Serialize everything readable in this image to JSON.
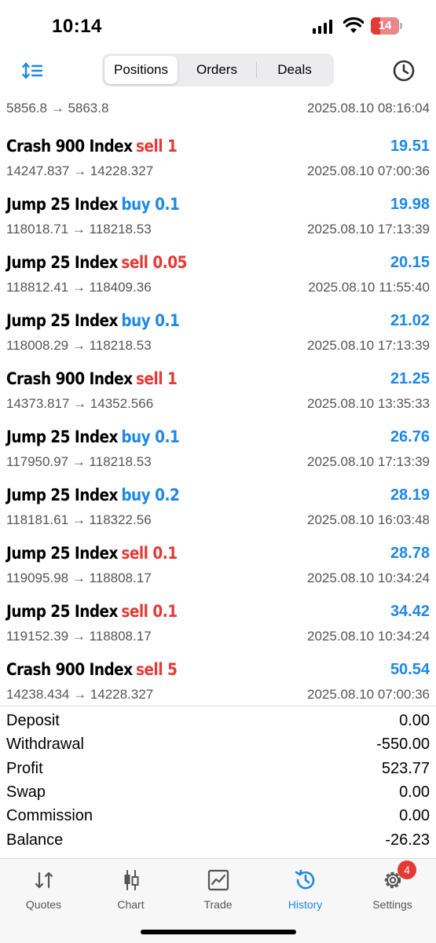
{
  "status_bar": {
    "time": "10:14",
    "battery": "14"
  },
  "header": {
    "segments": [
      "Positions",
      "Orders",
      "Deals"
    ],
    "active_segment": "Positions"
  },
  "partial_row": {
    "prices": "5856.8 → 5863.8",
    "time": "2025.08.10 08:16:04"
  },
  "deals": [
    {
      "symbol": "Crash 900 Index",
      "side": "sell",
      "volume": "1",
      "profit": "19.51",
      "prices": "14247.837 → 14228.327",
      "time": "2025.08.10 07:00:36"
    },
    {
      "symbol": "Jump 25 Index",
      "side": "buy",
      "volume": "0.1",
      "profit": "19.98",
      "prices": "118018.71 → 118218.53",
      "time": "2025.08.10 17:13:39"
    },
    {
      "symbol": "Jump 25 Index",
      "side": "sell",
      "volume": "0.05",
      "profit": "20.15",
      "prices": "118812.41 → 118409.36",
      "time": "2025.08.10 11:55:40"
    },
    {
      "symbol": "Jump 25 Index",
      "side": "buy",
      "volume": "0.1",
      "profit": "21.02",
      "prices": "118008.29 → 118218.53",
      "time": "2025.08.10 17:13:39"
    },
    {
      "symbol": "Crash 900 Index",
      "side": "sell",
      "volume": "1",
      "profit": "21.25",
      "prices": "14373.817 → 14352.566",
      "time": "2025.08.10 13:35:33"
    },
    {
      "symbol": "Jump 25 Index",
      "side": "buy",
      "volume": "0.1",
      "profit": "26.76",
      "prices": "117950.97 → 118218.53",
      "time": "2025.08.10 17:13:39"
    },
    {
      "symbol": "Jump 25 Index",
      "side": "buy",
      "volume": "0.2",
      "profit": "28.19",
      "prices": "118181.61 → 118322.56",
      "time": "2025.08.10 16:03:48"
    },
    {
      "symbol": "Jump 25 Index",
      "side": "sell",
      "volume": "0.1",
      "profit": "28.78",
      "prices": "119095.98 → 118808.17",
      "time": "2025.08.10 10:34:24"
    },
    {
      "symbol": "Jump 25 Index",
      "side": "sell",
      "volume": "0.1",
      "profit": "34.42",
      "prices": "119152.39 → 118808.17",
      "time": "2025.08.10 10:34:24"
    },
    {
      "symbol": "Crash 900 Index",
      "side": "sell",
      "volume": "5",
      "profit": "50.54",
      "prices": "14238.434 → 14228.327",
      "time": "2025.08.10 07:00:36"
    }
  ],
  "summary": [
    {
      "label": "Deposit",
      "value": "0.00"
    },
    {
      "label": "Withdrawal",
      "value": "-550.00"
    },
    {
      "label": "Profit",
      "value": "523.77"
    },
    {
      "label": "Swap",
      "value": "0.00"
    },
    {
      "label": "Commission",
      "value": "0.00"
    },
    {
      "label": "Balance",
      "value": "-26.23"
    }
  ],
  "tabbar": {
    "tabs": [
      {
        "label": "Quotes",
        "icon": "quotes-arrows-icon"
      },
      {
        "label": "Chart",
        "icon": "candlestick-icon"
      },
      {
        "label": "Trade",
        "icon": "trade-chart-icon"
      },
      {
        "label": "History",
        "icon": "history-clock-icon"
      },
      {
        "label": "Settings",
        "icon": "gear-icon"
      }
    ],
    "active_tab": "History",
    "settings_badge": "4"
  },
  "colors": {
    "accent": "#1e88e5",
    "sell": "#e53935",
    "buy": "#1e88e5"
  }
}
